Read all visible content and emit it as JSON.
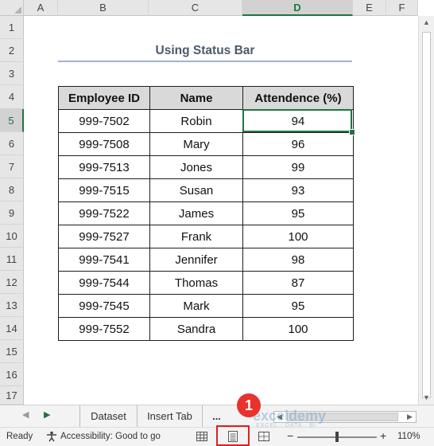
{
  "columns": [
    "A",
    "B",
    "C",
    "D",
    "E",
    "F"
  ],
  "selected_column": "D",
  "rows": [
    "1",
    "2",
    "3",
    "4",
    "5",
    "6",
    "7",
    "8",
    "9",
    "10",
    "11",
    "12",
    "13",
    "14",
    "15",
    "16",
    "17"
  ],
  "selected_row": "5",
  "sheet": {
    "title": "Using Status Bar",
    "headers": [
      "Employee ID",
      "Name",
      "Attendence (%)"
    ],
    "records": [
      [
        "999-7502",
        "Robin",
        "94"
      ],
      [
        "999-7508",
        "Mary",
        "96"
      ],
      [
        "999-7513",
        "Jones",
        "99"
      ],
      [
        "999-7515",
        "Susan",
        "93"
      ],
      [
        "999-7522",
        "James",
        "95"
      ],
      [
        "999-7527",
        "Frank",
        "100"
      ],
      [
        "999-7541",
        "Jennifer",
        "98"
      ],
      [
        "999-7544",
        "Thomas",
        "87"
      ],
      [
        "999-7545",
        "Mark",
        "95"
      ],
      [
        "999-7552",
        "Sandra",
        "100"
      ]
    ]
  },
  "tabs": {
    "sheet1": "Dataset",
    "sheet2": "Insert Tab",
    "more": "..."
  },
  "status": {
    "ready": "Ready",
    "accessibility": "Accessibility: Good to go",
    "zoom": "110%",
    "zoom_minus": "−",
    "zoom_plus": "+"
  },
  "annotation": {
    "badge": "1"
  },
  "watermark": {
    "brand": "exceldemy",
    "tagline": "EXCEL · DATA · BI"
  },
  "colors": {
    "accent": "#217346",
    "highlight": "#e02020"
  }
}
